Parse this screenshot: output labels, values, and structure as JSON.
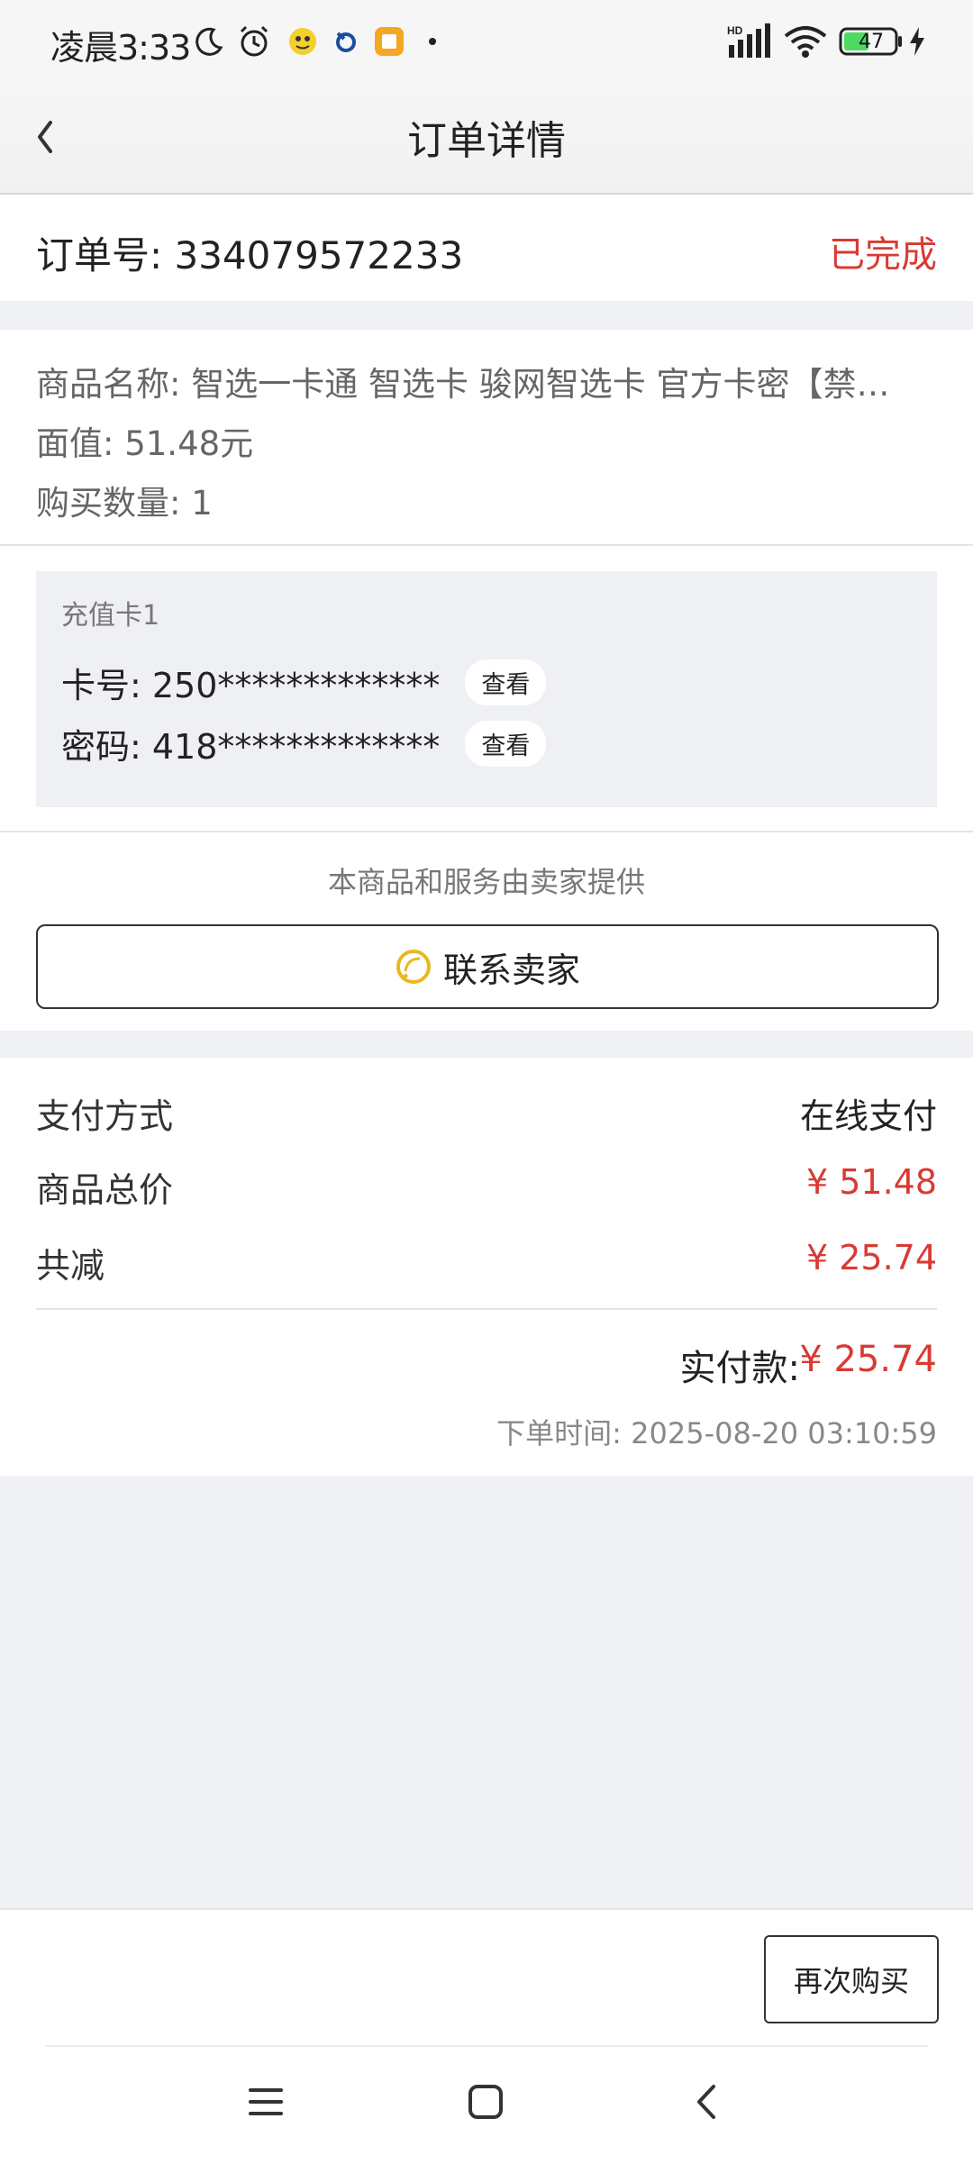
{
  "status_bar": {
    "time": "凌晨3:33",
    "signal_label": "HD",
    "battery": "47"
  },
  "nav": {
    "title": "订单详情"
  },
  "order": {
    "number_label": "订单号: 334079572233",
    "status": "已完成"
  },
  "goods": {
    "name": "商品名称:  智选一卡通 智选卡 骏网智选卡 官方卡密【禁…",
    "face_value": "面值:  51.48元",
    "quantity": "购买数量:  1"
  },
  "recharge_card": {
    "title": "充值卡1",
    "card_no": "卡号: 250*************",
    "password": "密码: 418*************",
    "view_label": "查看"
  },
  "seller": {
    "note": "本商品和服务由卖家提供",
    "contact_label": "联系卖家"
  },
  "payment": {
    "method_label": "支付方式",
    "method_value": "在线支付",
    "total_label": "商品总价",
    "total_value": "¥ 51.48",
    "discount_label": "共减",
    "discount_value": "¥ 25.74",
    "paid_label": "实付款:",
    "paid_value": "¥ 25.74",
    "order_time": "下单时间:  2025-08-20 03:10:59"
  },
  "bottom": {
    "rebuy_label": "再次购买"
  },
  "colors": {
    "accent_red": "#d93a33",
    "page_bg": "#f0f1f5",
    "card_bg": "#eef0f4"
  }
}
